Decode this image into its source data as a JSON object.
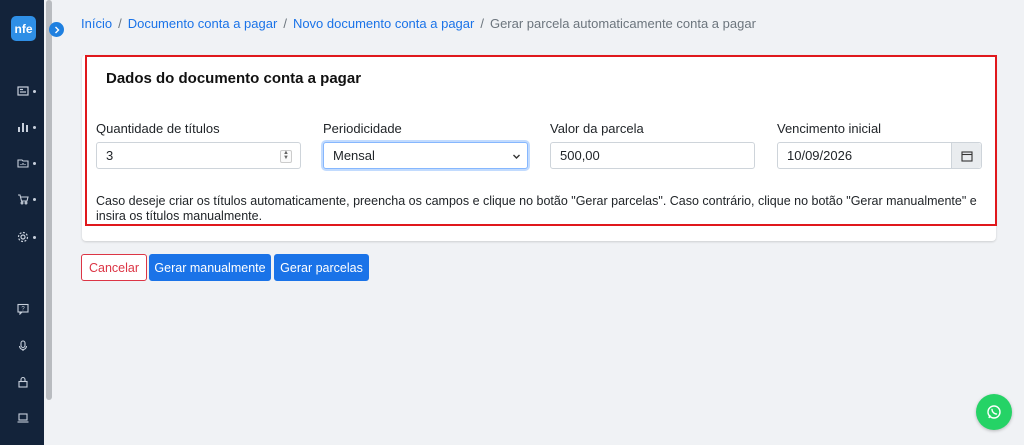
{
  "app": {
    "logo_text": "nfe"
  },
  "sidebar": {
    "icons": [
      "newspaper-icon",
      "bar-chart-icon",
      "folder-chart-icon",
      "cart-icon",
      "gear-icon",
      "help-chat-icon",
      "microphone-icon",
      "lock-icon",
      "laptop-icon"
    ]
  },
  "breadcrumb": {
    "items": [
      "Início",
      "Documento conta a pagar",
      "Novo documento conta a pagar"
    ],
    "current": "Gerar parcela automaticamente conta a pagar",
    "separator": "/"
  },
  "form": {
    "title": "Dados do documento conta a pagar",
    "quantidade": {
      "label": "Quantidade de títulos",
      "value": "3"
    },
    "periodicidade": {
      "label": "Periodicidade",
      "value": "Mensal"
    },
    "valor": {
      "label": "Valor da parcela",
      "value": "500,00"
    },
    "vencimento": {
      "label": "Vencimento inicial",
      "value": "10/09/2026"
    },
    "help": "Caso deseje criar os títulos automaticamente, preencha os campos e clique no botão \"Gerar parcelas\". Caso contrário, clique no botão \"Gerar manualmente\" e insira os títulos manualmente."
  },
  "actions": {
    "cancel": "Cancelar",
    "manual": "Gerar manualmente",
    "parcelas": "Gerar parcelas"
  },
  "colors": {
    "primary": "#1a73e8",
    "danger": "#dc3545",
    "sidebar": "#13233a",
    "highlight": "#e0181c",
    "whatsapp": "#25d366"
  }
}
